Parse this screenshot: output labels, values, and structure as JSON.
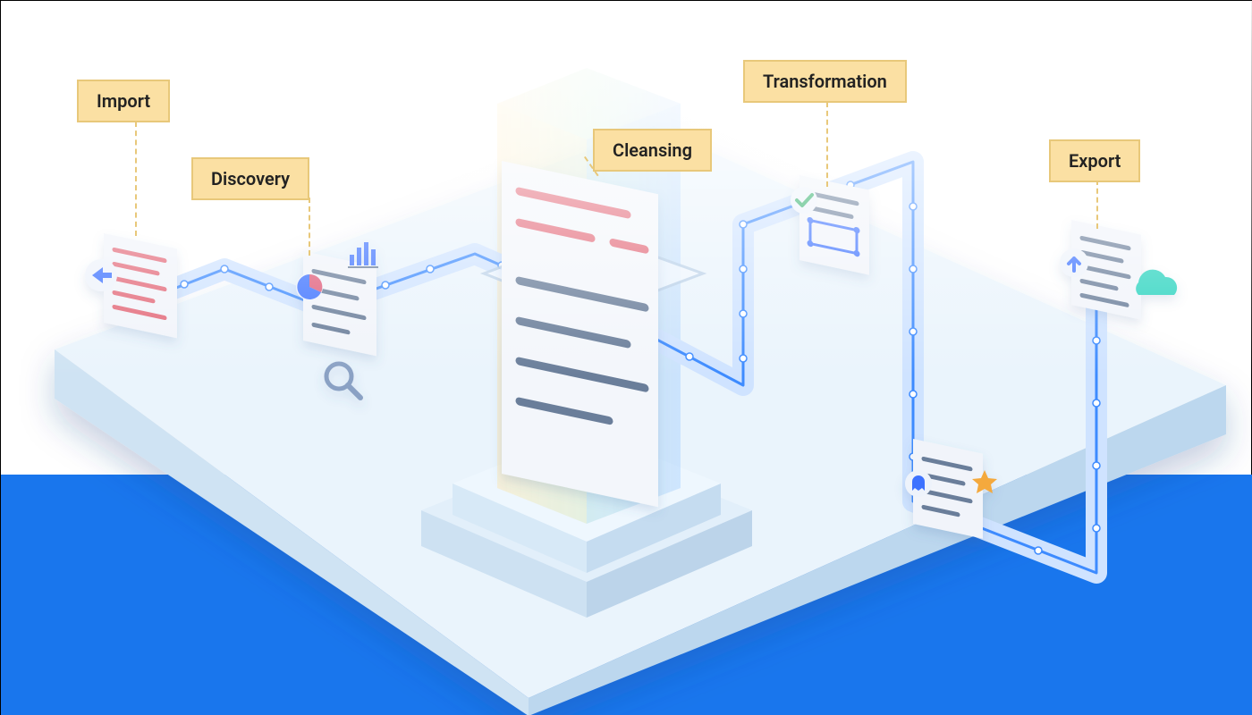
{
  "stages": {
    "import": {
      "label": "Import"
    },
    "discovery": {
      "label": "Discovery"
    },
    "cleansing": {
      "label": "Cleansing"
    },
    "transformation": {
      "label": "Transformation"
    },
    "export": {
      "label": "Export"
    }
  },
  "flow_sequence": [
    "import",
    "discovery",
    "cleansing",
    "transformation",
    "export"
  ],
  "colors": {
    "label_bg": "#fbe0a3",
    "label_border": "#e8c87a",
    "platform_light": "#eaf4fc",
    "platform_dark": "#d0e5f5",
    "ocean": "#1976ed",
    "pipe_stroke": "#3d8bff",
    "pipe_fill": "#cde4ff",
    "doc_bad_line": "#e36a7a",
    "doc_good_line": "#6a7e9a",
    "accent_teal": "#2ad3bf"
  }
}
